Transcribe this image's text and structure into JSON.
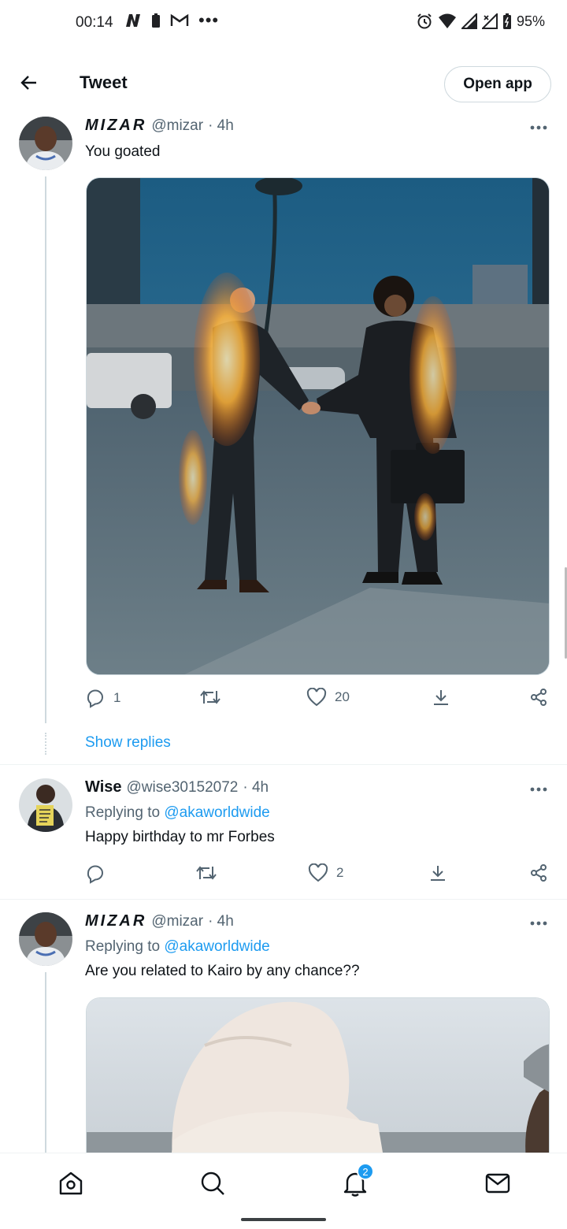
{
  "status_bar": {
    "time": "00:14",
    "battery": "95%",
    "left_icons": [
      "notification-n-icon",
      "battery-saver-icon",
      "gmail-icon",
      "more-dots-icon"
    ],
    "right_icons": [
      "alarm-icon",
      "wifi-icon",
      "signal-icon",
      "signal-x-icon",
      "battery-icon"
    ]
  },
  "header": {
    "title": "Tweet",
    "open_app_label": "Open app"
  },
  "tweets": [
    {
      "name": "MIZAR",
      "handle": "@mizar",
      "time": "· 4h",
      "text": "You goated",
      "actions": {
        "replies": "1",
        "retweets": "",
        "likes": "20"
      },
      "show_replies_label": "Show replies"
    },
    {
      "name": "Wise",
      "handle": "@wise30152072",
      "time": "· 4h",
      "replying_prefix": "Replying to",
      "replying_to": "@akaworldwide",
      "text": "Happy birthday to mr Forbes",
      "actions": {
        "replies": "",
        "retweets": "",
        "likes": "2"
      }
    },
    {
      "name": "MIZAR",
      "handle": "@mizar",
      "time": "· 4h",
      "replying_prefix": "Replying to",
      "replying_to": "@akaworldwide",
      "text": "Are you related to Kairo by any chance??"
    }
  ],
  "bottom_nav": {
    "items": [
      "home-icon",
      "search-icon",
      "notifications-icon",
      "messages-icon"
    ],
    "notifications_badge": "2"
  },
  "colors": {
    "accent": "#1d9bf0",
    "secondary_text": "#536471",
    "border": "#cfd9de"
  }
}
